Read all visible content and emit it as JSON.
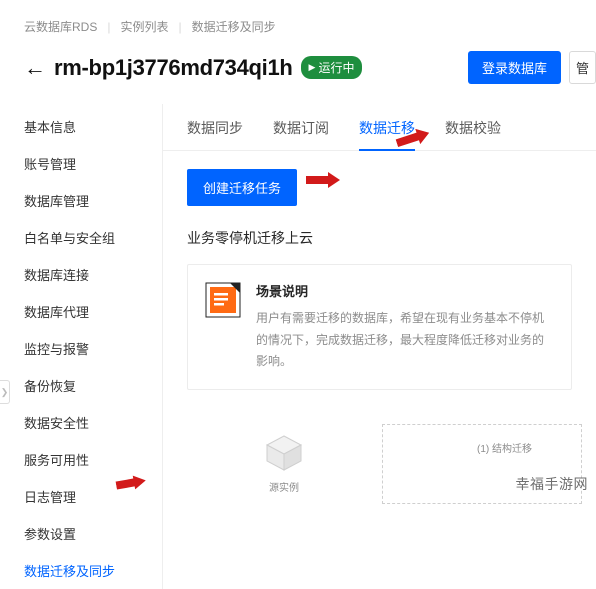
{
  "breadcrumb": {
    "root": "云数据库RDS",
    "mid": "实例列表",
    "current": "数据迁移及同步"
  },
  "header": {
    "instance_name": "rm-bp1j3776md734qi1h",
    "status": "运行中",
    "login_db": "登录数据库",
    "more": "管"
  },
  "sidebar": {
    "items": [
      "基本信息",
      "账号管理",
      "数据库管理",
      "白名单与安全组",
      "数据库连接",
      "数据库代理",
      "监控与报警",
      "备份恢复",
      "数据安全性",
      "服务可用性",
      "日志管理",
      "参数设置",
      "数据迁移及同步"
    ],
    "active_index": 12
  },
  "tabs": {
    "items": [
      "数据同步",
      "数据订阅",
      "数据迁移",
      "数据校验"
    ],
    "active_index": 2
  },
  "main": {
    "create_btn": "创建迁移任务",
    "section_title": "业务零停机迁移上云",
    "scene": {
      "title": "场景说明",
      "desc": "用户有需要迁移的数据库，希望在现有业务基本不停机的情况下，完成数据迁移，最大程度降低迁移对业务的影响。"
    },
    "diagram": {
      "source_label": "源实例",
      "step1": "(1) 结构迁移"
    }
  },
  "watermark": "幸福手游网"
}
